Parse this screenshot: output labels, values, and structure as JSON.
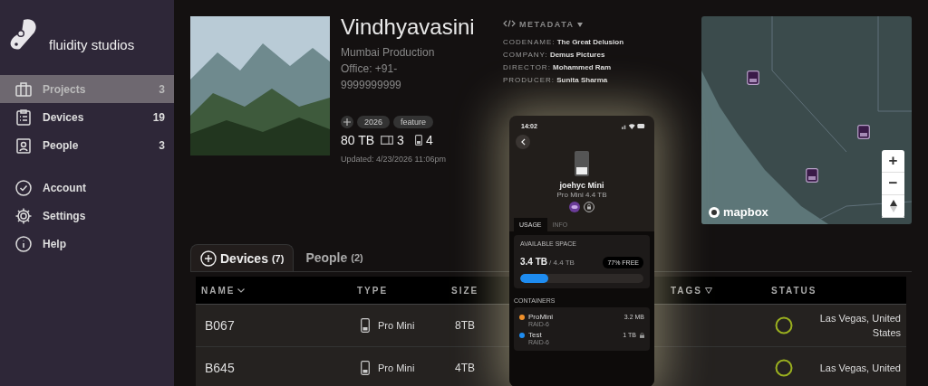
{
  "brand": {
    "name": "fluidity studios"
  },
  "sidebar": {
    "items": [
      {
        "label": "Projects",
        "count": "3",
        "selected": true
      },
      {
        "label": "Devices",
        "count": "19",
        "selected": false
      },
      {
        "label": "People",
        "count": "3",
        "selected": false
      }
    ],
    "secondary": [
      {
        "label": "Account"
      },
      {
        "label": "Settings"
      },
      {
        "label": "Help"
      }
    ]
  },
  "project": {
    "title": "Vindhyavasini",
    "subtitle": "Mumbai Production",
    "office": "Office: +91-9999999999",
    "tags": [
      "2026",
      "feature"
    ],
    "storage": "80 TB",
    "drives": "3",
    "phones": "4",
    "updated": "Updated: 4/23/2026 11:06pm"
  },
  "metadata": {
    "heading": "METADATA",
    "fields": [
      {
        "label": "CODENAME:",
        "value": "The Great Delusion"
      },
      {
        "label": "COMPANY:",
        "value": "Demus Pictures"
      },
      {
        "label": "DIRECTOR:",
        "value": "Mohammed Ram"
      },
      {
        "label": "PRODUCER:",
        "value": "Sunita Sharma"
      }
    ]
  },
  "map": {
    "attribution": "mapbox",
    "zoom_in": "+",
    "zoom_out": "−"
  },
  "tabs": [
    {
      "label": "Devices",
      "count": "(7)",
      "selected": true
    },
    {
      "label": "People",
      "count": "(2)",
      "selected": false
    }
  ],
  "table": {
    "columns": [
      {
        "label": "NAME",
        "kind": "sort"
      },
      {
        "label": "TYPE",
        "kind": "plain"
      },
      {
        "label": "SIZE",
        "kind": "plain"
      },
      {
        "label": "TAGS",
        "kind": "filter"
      },
      {
        "label": "STATUS",
        "kind": "plain"
      }
    ],
    "rows": [
      {
        "name": "B067",
        "type": "Pro Mini",
        "size": "8TB",
        "status": "Las Vegas, United States"
      },
      {
        "name": "B645",
        "type": "Pro Mini",
        "size": "4TB",
        "status": "Las Vegas, United"
      }
    ]
  },
  "phone": {
    "time": "14:02",
    "device_name": "joehyc Mini",
    "device_model": "Pro Mini 4.4 TB",
    "tabs": [
      {
        "label": "USAGE",
        "selected": true
      },
      {
        "label": "INFO",
        "selected": false
      }
    ],
    "space_label": "AVAILABLE SPACE",
    "used": "3.4 TB",
    "total": "/ 4.4 TB",
    "free": "77% FREE",
    "level": 0.23,
    "containers_label": "CONTAINERS",
    "containers": [
      {
        "name": "ProMini",
        "raid": "RAID-6",
        "size": "3.2 MB",
        "color": "#f0902a",
        "locked": false
      },
      {
        "name": "Test",
        "raid": "RAID-6",
        "size": "1 TB",
        "color": "#1e8cf0",
        "locked": true
      }
    ]
  }
}
